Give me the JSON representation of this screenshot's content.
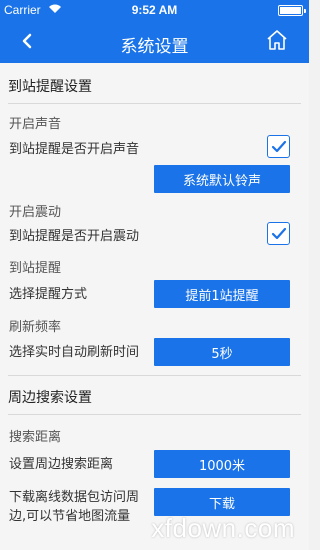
{
  "status": {
    "carrier": "Carrier",
    "time": "9:52 AM"
  },
  "nav": {
    "title": "系统设置"
  },
  "station": {
    "section_title": "到站提醒设置",
    "sound_title": "开启声音",
    "sound_label": "到站提醒是否开启声音",
    "sound_checked": true,
    "ringtone_button": "系统默认铃声",
    "vibrate_title": "开启震动",
    "vibrate_label": "到站提醒是否开启震动",
    "vibrate_checked": true,
    "remind_title": "到站提醒",
    "remind_label": "选择提醒方式",
    "remind_button": "提前1站提醒",
    "refresh_title": "刷新频率",
    "refresh_label": "选择实时自动刷新时间",
    "refresh_button": "5秒"
  },
  "nearby": {
    "section_title": "周边搜索设置",
    "distance_title": "搜索距离",
    "distance_label": "设置周边搜索距离",
    "distance_button": "1000米",
    "download_label_line1": "下载离线数据包访问周",
    "download_label_line2": "边,可以节省地图流量",
    "download_button": "下载"
  },
  "watermark": "xfdown.com",
  "colors": {
    "accent": "#1a73e8"
  }
}
